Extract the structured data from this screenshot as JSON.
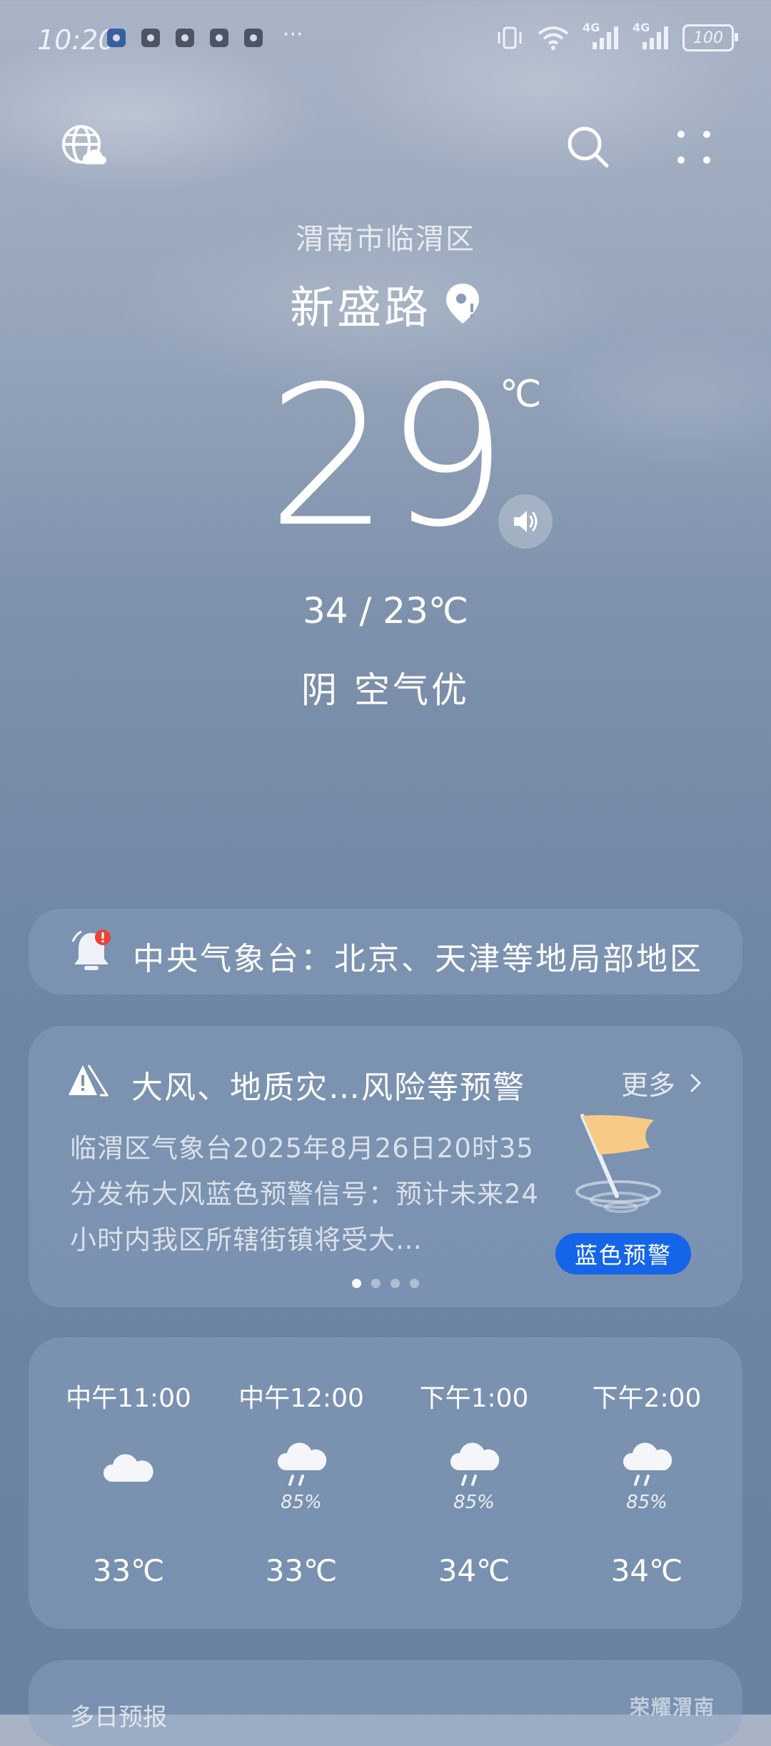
{
  "status_bar": {
    "time": "10:20",
    "more": "···",
    "network_1": "4G",
    "network_2": "4G",
    "battery": "100"
  },
  "location": {
    "district": "渭南市临渭区",
    "street": "新盛路"
  },
  "current": {
    "temperature": "29",
    "unit": "℃",
    "range": "34 / 23℃",
    "condition": "阴  空气优"
  },
  "alert_banner": {
    "text": "中央气象台：北京、天津等地局部地区"
  },
  "warning": {
    "title": "大风、地质灾…风险等预警",
    "more_label": "更多",
    "body": "临渭区气象台2025年8月26日20时35分发布大风蓝色预警信号：预计未来24小时内我区所辖街镇将受大…",
    "badge": "蓝色预警",
    "badge_color": "#1565e8",
    "page_count": 4,
    "active_page": 1
  },
  "hourly": [
    {
      "time": "中午11:00",
      "icon": "cloudy-icon",
      "pop": "",
      "temp": "33℃"
    },
    {
      "time": "中午12:00",
      "icon": "rain-icon",
      "pop": "85%",
      "temp": "33℃"
    },
    {
      "time": "下午1:00",
      "icon": "rain-icon",
      "pop": "85%",
      "temp": "34℃"
    },
    {
      "time": "下午2:00",
      "icon": "rain-icon",
      "pop": "85%",
      "temp": "34℃"
    }
  ],
  "forecast": {
    "title": "多日预报"
  },
  "watermark": "荣耀渭南"
}
